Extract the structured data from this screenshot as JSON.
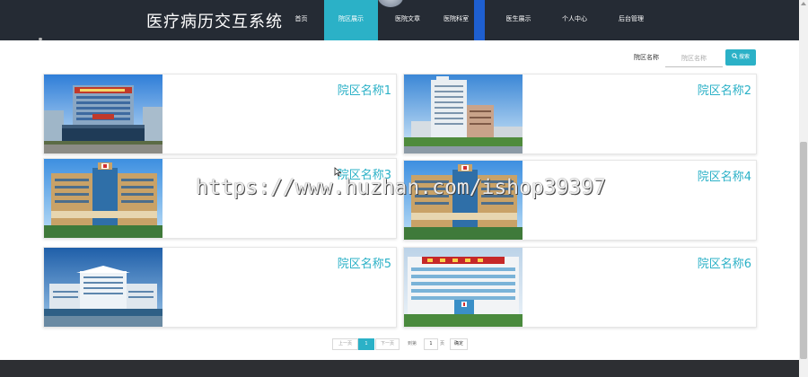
{
  "header": {
    "site_title": "医疗病历交互系统",
    "nav": [
      "首页",
      "院区展示",
      "医院文章",
      "医院科室",
      "医生展示",
      "个人中心",
      "后台管理"
    ]
  },
  "search": {
    "label": "院区名称",
    "placeholder": "院区名称",
    "button_label": "搜索"
  },
  "cards": [
    {
      "name": "院区名称1"
    },
    {
      "name": "院区名称2"
    },
    {
      "name": "院区名称3"
    },
    {
      "name": "院区名称4"
    },
    {
      "name": "院区名称5"
    },
    {
      "name": "院区名称6"
    }
  ],
  "pagination": {
    "prev": "上一页",
    "current": "1",
    "next": "下一页",
    "goto_label": "到第",
    "page_input": "1",
    "page_unit": "页",
    "confirm": "确定"
  },
  "watermark": "https://www.huzhan.com/ishop39397",
  "colors": {
    "accent": "#2bb1c7",
    "header_bg": "#252b34",
    "footer_bg": "#2d2f33"
  }
}
